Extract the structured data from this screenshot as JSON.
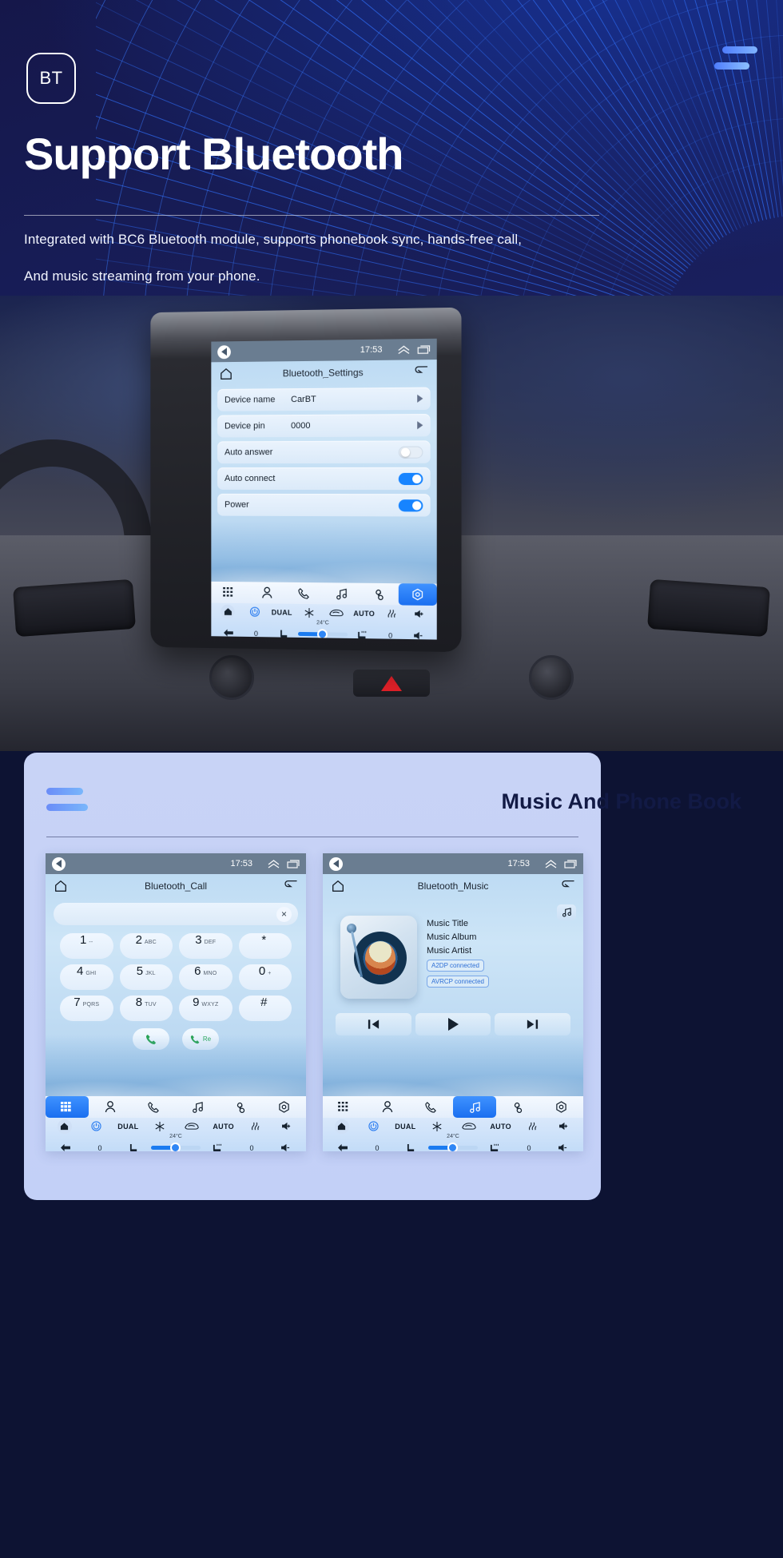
{
  "hero": {
    "badge": "BT",
    "title": "Support Bluetooth",
    "desc_line1": "Integrated with BC6 Bluetooth module, supports phonebook sync, hands-free call,",
    "desc_line2": "And music streaming from your phone.",
    "menu_icon": "hamburger-icon",
    "accent": "#4f7dfc"
  },
  "settings_screen": {
    "status": {
      "time": "17:53",
      "back_icon": "back-circle-icon",
      "collapse_icon": "chevron-up-icon",
      "recents_icon": "recents-icon"
    },
    "title": "Bluetooth_Settings",
    "home_icon": "home-icon",
    "back_icon": "return-arrow-icon",
    "rows": [
      {
        "label": "Device name",
        "value": "CarBT",
        "control": "chevron"
      },
      {
        "label": "Device pin",
        "value": "0000",
        "control": "chevron"
      },
      {
        "label": "Auto answer",
        "value": "",
        "control": "toggle-off"
      },
      {
        "label": "Auto connect",
        "value": "",
        "control": "toggle-on"
      },
      {
        "label": "Power",
        "value": "",
        "control": "toggle-on"
      }
    ],
    "dock": [
      "apps-icon",
      "contacts-icon",
      "phone-icon",
      "music-icon",
      "link-icon",
      "settings-icon"
    ],
    "dock_active_index": 5,
    "climate": {
      "home_icon": "home-icon",
      "power_icon": "power-icon",
      "dual": "DUAL",
      "snow_icon": "snowflake-icon",
      "recirc_icon": "recirculation-icon",
      "auto": "AUTO",
      "defrost_icon": "defrost-icon",
      "vol_up_icon": "volume-up-icon",
      "back_icon": "back-arrow-icon",
      "left_temp": "0",
      "seat_icon": "seat-icon",
      "fan_temp": "24°C",
      "heated_seat_icon": "heated-seat-icon",
      "right_temp": "0",
      "vol_down_icon": "volume-down-icon"
    }
  },
  "panel": {
    "heading": "Music And Phone Book",
    "menu_icon": "hamburger-icon"
  },
  "call_screen": {
    "status": {
      "time": "17:53"
    },
    "title": "Bluetooth_Call",
    "search_placeholder": "",
    "clear_icon": "close-icon",
    "keys": [
      {
        "n": "1",
        "s": "--"
      },
      {
        "n": "2",
        "s": "ABC"
      },
      {
        "n": "3",
        "s": "DEF"
      },
      {
        "n": "*",
        "s": ""
      },
      {
        "n": "4",
        "s": "GHI"
      },
      {
        "n": "5",
        "s": "JKL"
      },
      {
        "n": "6",
        "s": "MNO"
      },
      {
        "n": "0",
        "s": "+"
      },
      {
        "n": "7",
        "s": "PQRS"
      },
      {
        "n": "8",
        "s": "TUV"
      },
      {
        "n": "9",
        "s": "WXYZ"
      },
      {
        "n": "#",
        "s": ""
      }
    ],
    "call_button_icon": "phone-call-icon",
    "redial_label": "Re",
    "dock_active_index": 0
  },
  "music_screen": {
    "status": {
      "time": "17:53"
    },
    "title": "Bluetooth_Music",
    "playlist_icon": "playlist-icon",
    "track_title": "Music Title",
    "track_album": "Music Album",
    "track_artist": "Music Artist",
    "badges": [
      "A2DP  connected",
      "AVRCP connected"
    ],
    "transport": [
      "previous-icon",
      "play-icon",
      "next-icon"
    ],
    "dock_active_index": 3
  }
}
